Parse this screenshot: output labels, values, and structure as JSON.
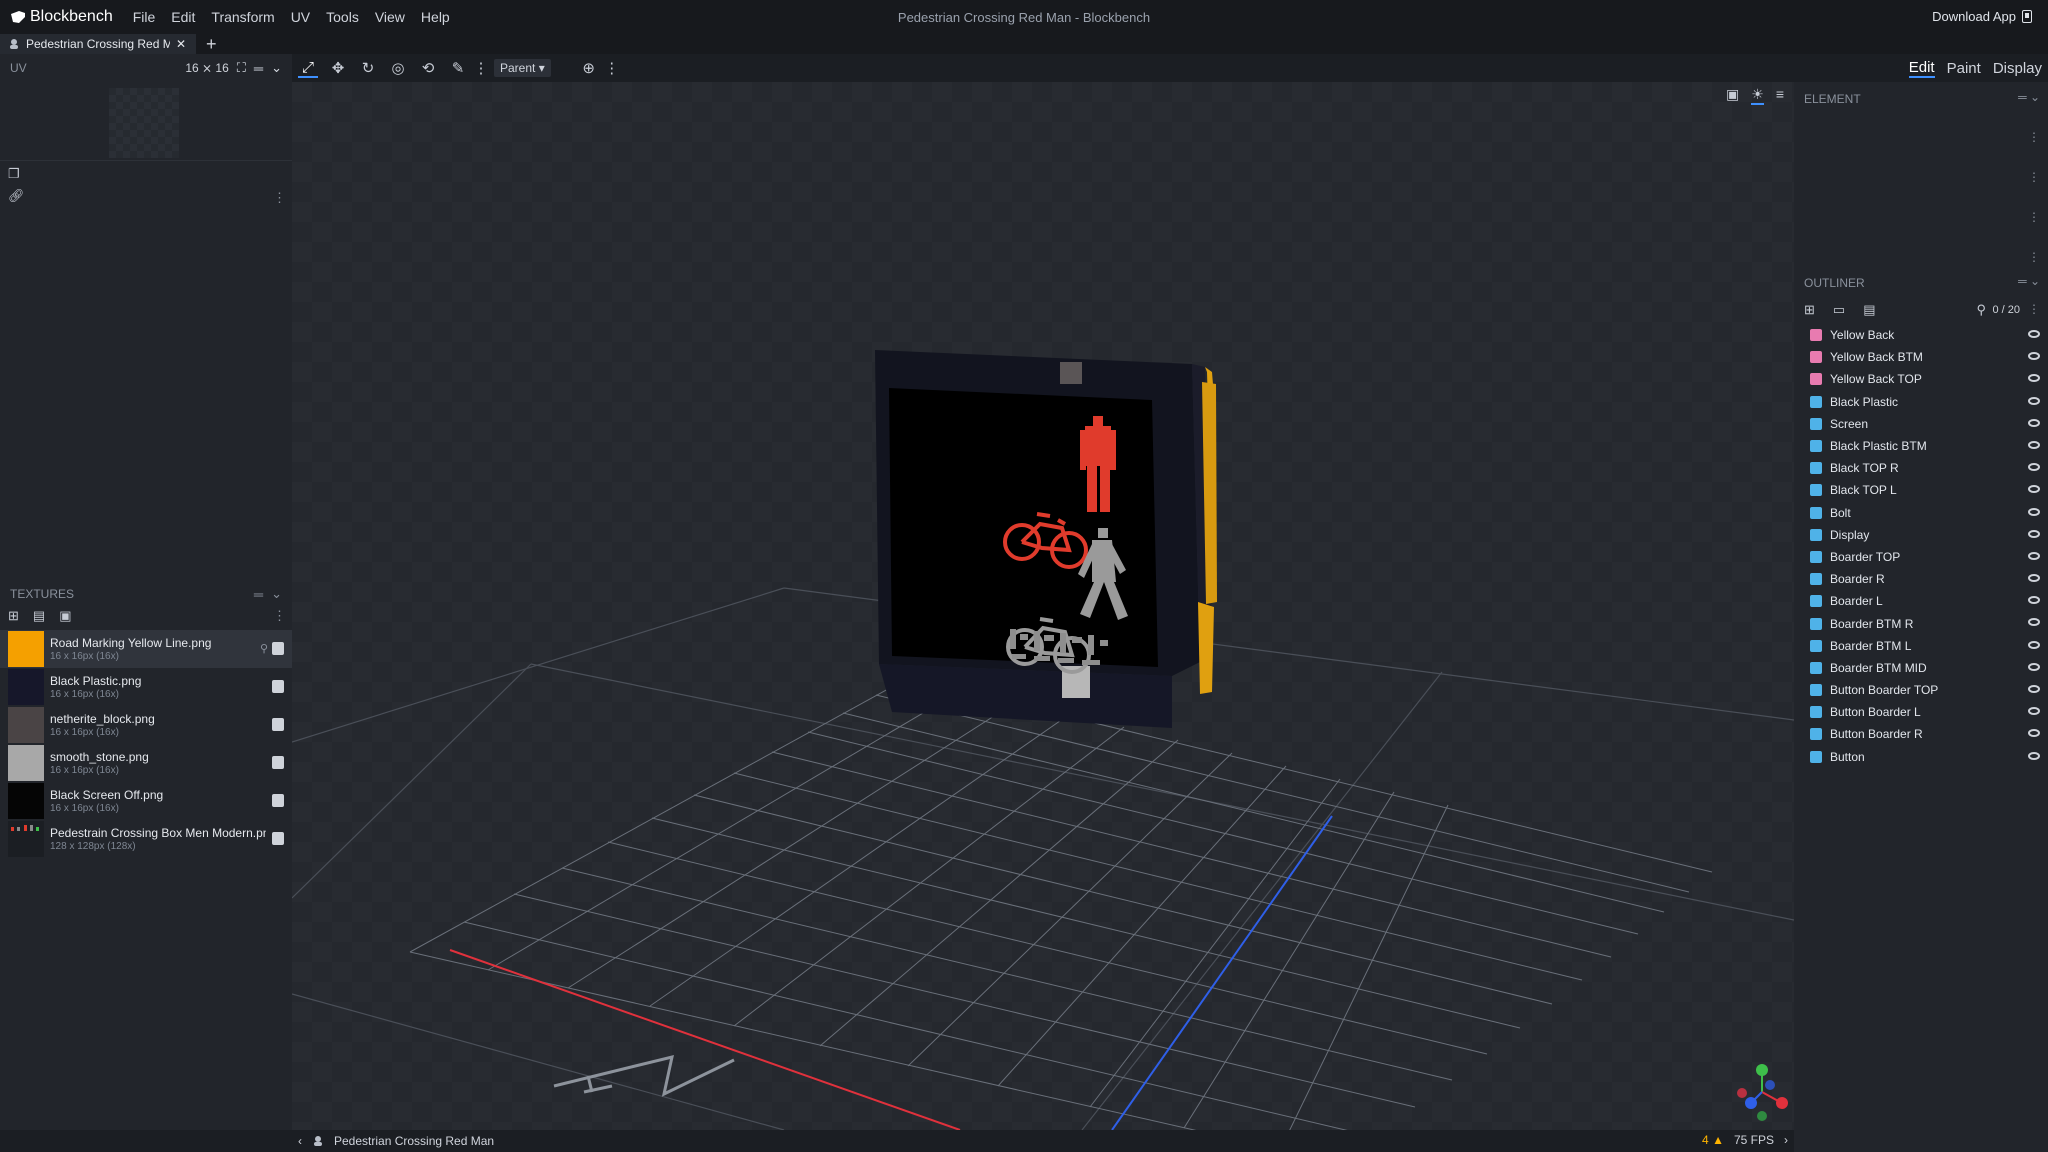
{
  "app": {
    "name": "Blockbench",
    "window_title": "Pedestrian Crossing Red Man - Blockbench",
    "download_label": "Download App"
  },
  "menu": [
    "File",
    "Edit",
    "Transform",
    "UV",
    "Tools",
    "View",
    "Help"
  ],
  "tab": {
    "label": "Pedestrian Crossing Red Man",
    "new_tab": "+"
  },
  "uv": {
    "title": "UV",
    "size": "16 ⨯ 16"
  },
  "toolbar": {
    "pivot": "Parent"
  },
  "modes": [
    "Edit",
    "Paint",
    "Display"
  ],
  "textures": {
    "title": "TEXTURES",
    "items": [
      {
        "name": "Road Marking Yellow Line.png",
        "size": "16 x 16px (16x)",
        "color": "#f5a000",
        "selected": true
      },
      {
        "name": "Black Plastic.png",
        "size": "16 x 16px (16x)",
        "color": "#16172a"
      },
      {
        "name": "netherite_block.png",
        "size": "16 x 16px (16x)",
        "color": "#4a4445"
      },
      {
        "name": "smooth_stone.png",
        "size": "16 x 16px (16x)",
        "color": "#a8a8a8"
      },
      {
        "name": "Black Screen Off.png",
        "size": "16 x 16px (16x)",
        "color": "#050505"
      },
      {
        "name": "Pedestrain Crossing Box Men Modern.png",
        "size": "128 x 128px (128x)",
        "color": "#1b1e23"
      }
    ]
  },
  "element": {
    "title": "ELEMENT"
  },
  "outliner": {
    "title": "OUTLINER",
    "count": "0 / 20",
    "items": [
      {
        "name": "Yellow Back",
        "icon_color": "#e87bb0"
      },
      {
        "name": "Yellow Back BTM",
        "icon_color": "#e87bb0"
      },
      {
        "name": "Yellow Back TOP",
        "icon_color": "#e87bb0"
      },
      {
        "name": "Black Plastic",
        "icon_color": "#4fb2e8"
      },
      {
        "name": "Screen",
        "icon_color": "#4fb2e8"
      },
      {
        "name": "Black Plastic BTM",
        "icon_color": "#4fb2e8"
      },
      {
        "name": "Black TOP R",
        "icon_color": "#4fb2e8"
      },
      {
        "name": "Black TOP L",
        "icon_color": "#4fb2e8"
      },
      {
        "name": "Bolt",
        "icon_color": "#4fb2e8"
      },
      {
        "name": "Display",
        "icon_color": "#4fb2e8"
      },
      {
        "name": "Boarder TOP",
        "icon_color": "#4fb2e8"
      },
      {
        "name": "Boarder R",
        "icon_color": "#4fb2e8"
      },
      {
        "name": "Boarder L",
        "icon_color": "#4fb2e8"
      },
      {
        "name": "Boarder BTM R",
        "icon_color": "#4fb2e8"
      },
      {
        "name": "Boarder BTM L",
        "icon_color": "#4fb2e8"
      },
      {
        "name": "Boarder BTM MID",
        "icon_color": "#4fb2e8"
      },
      {
        "name": "Button Boarder TOP",
        "icon_color": "#4fb2e8"
      },
      {
        "name": "Button Boarder L",
        "icon_color": "#4fb2e8"
      },
      {
        "name": "Button Boarder R",
        "icon_color": "#4fb2e8"
      },
      {
        "name": "Button",
        "icon_color": "#4fb2e8"
      }
    ]
  },
  "status": {
    "model_name": "Pedestrian Crossing Red Man",
    "warnings": "4",
    "fps": "75 FPS"
  },
  "colors": {
    "accent": "#3e90ff",
    "axis_x": "#e0313c",
    "axis_z": "#2f5fe8",
    "signal_red": "#e03b2c"
  }
}
